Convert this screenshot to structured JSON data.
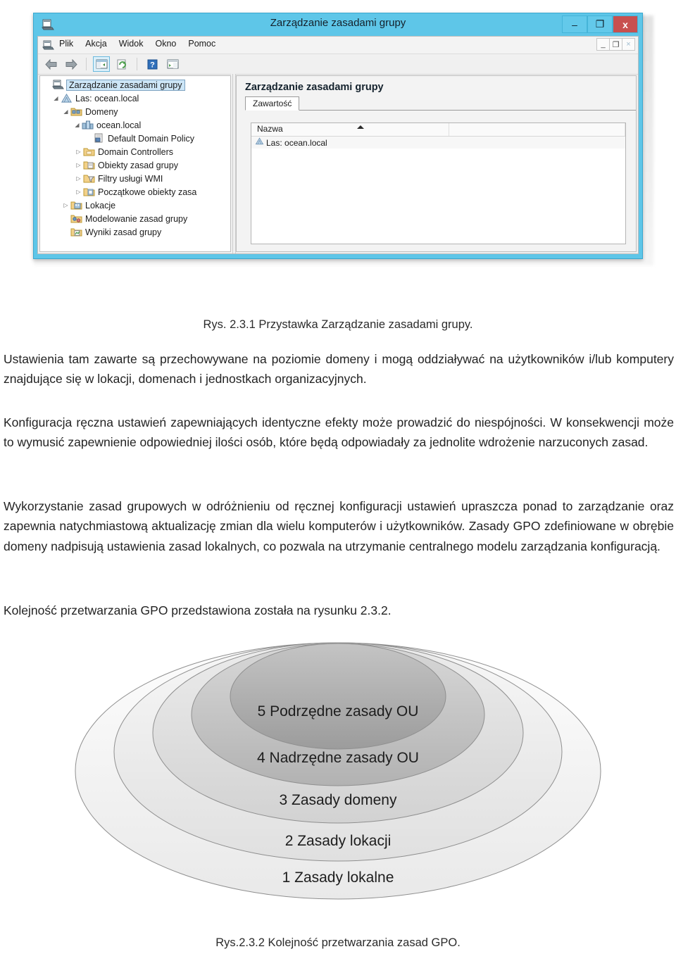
{
  "screenshot": {
    "window": {
      "title": "Zarządzanie zasadami grupy",
      "icon": "mmc-console-icon",
      "buttons": {
        "minimize": "–",
        "maximize": "❐",
        "close": "x"
      },
      "mdi_buttons": {
        "minimize": "_",
        "restore": "❐",
        "close": "×"
      }
    },
    "menu": [
      "Plik",
      "Akcja",
      "Widok",
      "Okno",
      "Pomoc"
    ],
    "toolbar": [
      {
        "name": "back-icon",
        "glyph": "⬅"
      },
      {
        "name": "forward-icon",
        "glyph": "➡"
      },
      {
        "name": "show-hide-tree-icon",
        "glyph": "▤"
      },
      {
        "name": "refresh-icon",
        "glyph": "⟳"
      },
      {
        "name": "help-icon",
        "glyph": "?"
      },
      {
        "name": "properties-icon",
        "glyph": "▥"
      }
    ],
    "tree": [
      {
        "label": "Zarządzanie zasadami grupy",
        "indent": 0,
        "arrow": "",
        "icon": "console-root-icon",
        "selected": true
      },
      {
        "label": "Las: ocean.local",
        "indent": 1,
        "arrow": "◢",
        "icon": "forest-icon",
        "selected": false
      },
      {
        "label": "Domeny",
        "indent": 2,
        "arrow": "◢",
        "icon": "domains-folder-icon",
        "selected": false
      },
      {
        "label": "ocean.local",
        "indent": 3,
        "arrow": "◢",
        "icon": "domain-icon",
        "selected": false
      },
      {
        "label": "Default Domain Policy",
        "indent": 4,
        "arrow": "",
        "icon": "gpo-icon",
        "selected": false
      },
      {
        "label": "Domain Controllers",
        "indent": 4,
        "arrow": "▷",
        "icon": "ou-folder-icon",
        "selected": false
      },
      {
        "label": "Obiekty zasad grupy",
        "indent": 4,
        "arrow": "▷",
        "icon": "gpo-folder-icon",
        "selected": false
      },
      {
        "label": "Filtry usługi WMI",
        "indent": 4,
        "arrow": "▷",
        "icon": "wmi-folder-icon",
        "selected": false
      },
      {
        "label": "Początkowe obiekty zasa",
        "indent": 4,
        "arrow": "▷",
        "icon": "starter-gpo-folder-icon",
        "selected": false
      },
      {
        "label": "Lokacje",
        "indent": 2,
        "arrow": "▷",
        "icon": "sites-folder-icon",
        "selected": false
      },
      {
        "label": "Modelowanie zasad grupy",
        "indent": 2,
        "arrow": "",
        "icon": "modeling-icon",
        "selected": false
      },
      {
        "label": "Wyniki zasad grupy",
        "indent": 2,
        "arrow": "",
        "icon": "results-icon",
        "selected": false
      }
    ],
    "detail": {
      "title": "Zarządzanie zasadami grupy",
      "tab": "Zawartość",
      "columns": [
        "Nazwa",
        ""
      ],
      "rows": [
        {
          "name": "Las: ocean.local",
          "icon": "forest-icon"
        }
      ]
    }
  },
  "document": {
    "figure1_caption": "Rys. 2.3.1 Przystawka Zarządzanie zasadami grupy.",
    "paragraph1": "Ustawienia tam zawarte są przechowywane na poziomie domeny i mogą oddziaływać na użytkowników i/lub komputery znajdujące się w lokacji, domenach i jednostkach organizacyjnych.",
    "paragraph2": "Konfiguracja ręczna ustawień zapewniających identyczne efekty może prowadzić do niespójności. W konsekwencji może to wymusić zapewnienie odpowiedniej ilości osób, które będą odpowiadały za jednolite wdrożenie narzuconych zasad.",
    "paragraph3": "Wykorzystanie zasad grupowych w odróżnieniu od ręcznej konfiguracji ustawień upraszcza ponad to zarządzanie oraz zapewnia natychmiastową aktualizację zmian dla wielu komputerów i użytkowników. Zasady GPO zdefiniowane w obrębie domeny nadpisują ustawienia zasad lokalnych, co pozwala na utrzymanie centralnego modelu zarządzania konfiguracją.",
    "paragraph4": "Kolejność przetwarzania GPO przedstawiona została na rysunku 2.3.2.",
    "figure2_caption": "Rys.2.3.2 Kolejność przetwarzania zasad GPO."
  },
  "chart_data": {
    "type": "pie",
    "title": "Kolejność przetwarzania zasad GPO",
    "layers": [
      {
        "order": 5,
        "label": "5 Podrzędne zasady OU",
        "fill": "#a8a8a8"
      },
      {
        "order": 4,
        "label": "4 Nadrzędne zasady OU",
        "fill": "#bcbcbc"
      },
      {
        "order": 3,
        "label": "3 Zasady domeny",
        "fill": "#d3d3d3"
      },
      {
        "order": 2,
        "label": "2 Zasady lokacji",
        "fill": "#e6e6e6"
      },
      {
        "order": 1,
        "label": "1 Zasady lokalne",
        "fill": "#f2f2f2"
      }
    ]
  }
}
